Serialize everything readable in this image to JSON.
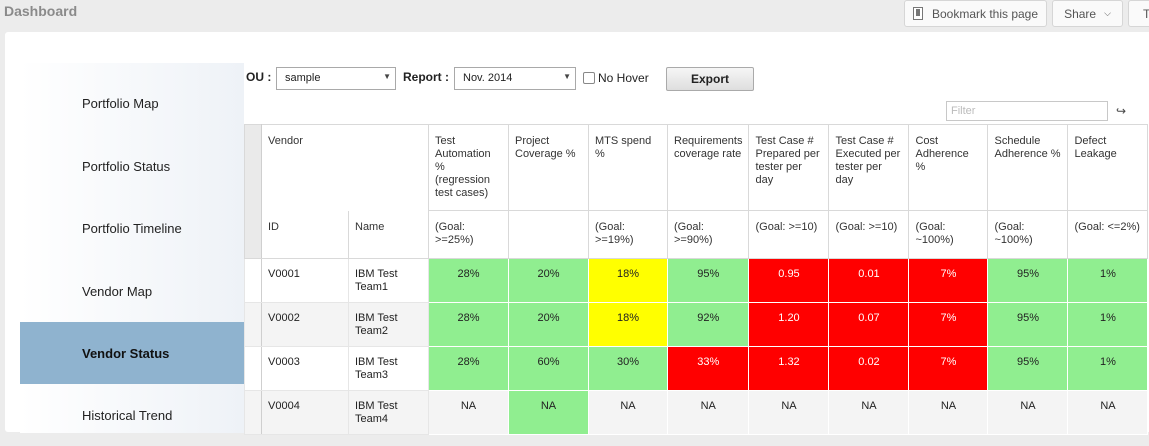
{
  "header": {
    "title": "Dashboard",
    "bookmark_label": "Bookmark this page",
    "share_label": "Share",
    "more_label": "T"
  },
  "sidebar": {
    "items": [
      {
        "label": "Portfolio Map",
        "active": false
      },
      {
        "label": "Portfolio Status",
        "active": false
      },
      {
        "label": "Portfolio Timeline",
        "active": false
      },
      {
        "label": "Vendor Map",
        "active": false
      },
      {
        "label": "Vendor Status",
        "active": true
      },
      {
        "label": "Historical Trend",
        "active": false
      }
    ]
  },
  "toolbar": {
    "ou_label": "OU :",
    "ou_value": "sample",
    "report_label": "Report :",
    "report_value": "Nov. 2014",
    "no_hover_label": "No Hover",
    "no_hover_checked": false,
    "export_label": "Export",
    "filter_placeholder": "Filter"
  },
  "table": {
    "vendor_header": "Vendor",
    "id_header": "ID",
    "name_header": "Name",
    "metrics": [
      {
        "label": "Test Automation % (regression test cases)",
        "goal": "(Goal: >=25%)"
      },
      {
        "label": "Project Coverage %",
        "goal": ""
      },
      {
        "label": "MTS spend %",
        "goal": "(Goal: >=19%)"
      },
      {
        "label": "Requirements coverage rate",
        "goal": "(Goal: >=90%)"
      },
      {
        "label": "Test Case # Prepared per tester per day",
        "goal": "(Goal: >=10)"
      },
      {
        "label": "Test Case # Executed per tester per day",
        "goal": "(Goal: >=10)"
      },
      {
        "label": "Cost Adherence %",
        "goal": "(Goal: ~100%)"
      },
      {
        "label": "Schedule Adherence %",
        "goal": "(Goal: ~100%)"
      },
      {
        "label": "Defect Leakage",
        "goal": "(Goal: <=2%)"
      }
    ],
    "status_colors": {
      "green": "#90ee90",
      "yellow": "#ffff00",
      "red": "#ff0000"
    },
    "rows": [
      {
        "id": "V0001",
        "name": "IBM Test Team1",
        "cells": [
          {
            "v": "28%",
            "s": "green"
          },
          {
            "v": "20%",
            "s": "green"
          },
          {
            "v": "18%",
            "s": "yellow"
          },
          {
            "v": "95%",
            "s": "green"
          },
          {
            "v": "0.95",
            "s": "red"
          },
          {
            "v": "0.01",
            "s": "red"
          },
          {
            "v": "7%",
            "s": "red"
          },
          {
            "v": "95%",
            "s": "green"
          },
          {
            "v": "1%",
            "s": "green"
          }
        ]
      },
      {
        "id": "V0002",
        "name": "IBM Test Team2",
        "cells": [
          {
            "v": "28%",
            "s": "green"
          },
          {
            "v": "20%",
            "s": "green"
          },
          {
            "v": "18%",
            "s": "yellow"
          },
          {
            "v": "92%",
            "s": "green"
          },
          {
            "v": "1.20",
            "s": "red"
          },
          {
            "v": "0.07",
            "s": "red"
          },
          {
            "v": "7%",
            "s": "red"
          },
          {
            "v": "95%",
            "s": "green"
          },
          {
            "v": "1%",
            "s": "green"
          }
        ]
      },
      {
        "id": "V0003",
        "name": "IBM Test Team3",
        "cells": [
          {
            "v": "28%",
            "s": "green"
          },
          {
            "v": "60%",
            "s": "green"
          },
          {
            "v": "30%",
            "s": "green"
          },
          {
            "v": "33%",
            "s": "red"
          },
          {
            "v": "1.32",
            "s": "red"
          },
          {
            "v": "0.02",
            "s": "red"
          },
          {
            "v": "7%",
            "s": "red"
          },
          {
            "v": "95%",
            "s": "green"
          },
          {
            "v": "1%",
            "s": "green"
          }
        ]
      },
      {
        "id": "V0004",
        "name": "IBM Test Team4",
        "cells": [
          {
            "v": "NA",
            "s": ""
          },
          {
            "v": "NA",
            "s": "green"
          },
          {
            "v": "NA",
            "s": ""
          },
          {
            "v": "NA",
            "s": ""
          },
          {
            "v": "NA",
            "s": ""
          },
          {
            "v": "NA",
            "s": ""
          },
          {
            "v": "NA",
            "s": ""
          },
          {
            "v": "NA",
            "s": ""
          },
          {
            "v": "NA",
            "s": ""
          }
        ]
      }
    ]
  }
}
